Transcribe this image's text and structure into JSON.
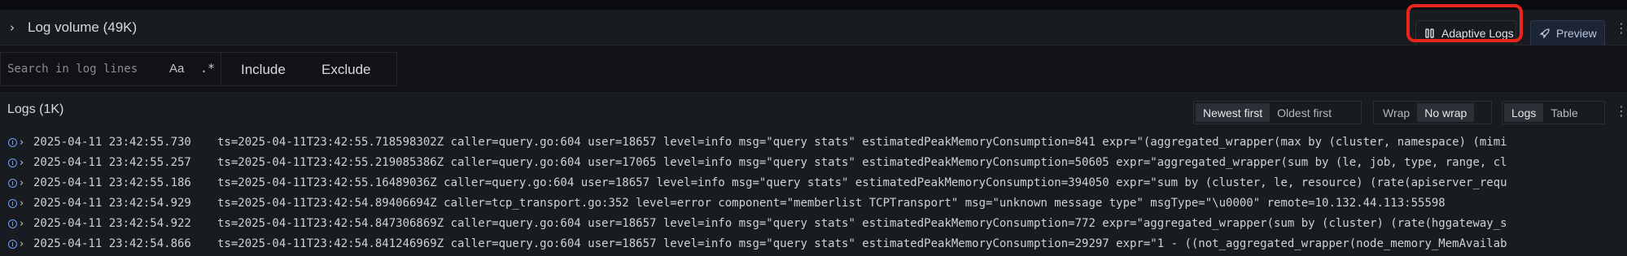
{
  "log_volume": {
    "title": "Log volume (49K)",
    "adaptive_logs_label": "Adaptive Logs",
    "preview_label": "Preview"
  },
  "search": {
    "placeholder": "Search in log lines",
    "case_label": "Aa",
    "regex_label": ".*",
    "include_label": "Include",
    "exclude_label": "Exclude"
  },
  "logs": {
    "title": "Logs (1K)",
    "sort_options": [
      "Newest first",
      "Oldest first"
    ],
    "sort_selected": "Newest first",
    "wrap_options": [
      "Wrap",
      "No wrap"
    ],
    "wrap_selected": "No wrap",
    "view_options": [
      "Logs",
      "Table"
    ],
    "view_selected": "Logs",
    "rows": [
      {
        "level": "info",
        "timestamp": "2025-04-11 23:42:55.730",
        "line": "ts=2025-04-11T23:42:55.718598302Z caller=query.go:604 user=18657 level=info msg=\"query stats\" estimatedPeakMemoryConsumption=841 expr=\"(aggregated_wrapper(max by (cluster, namespace) (mimi"
      },
      {
        "level": "info",
        "timestamp": "2025-04-11 23:42:55.257",
        "line": "ts=2025-04-11T23:42:55.219085386Z caller=query.go:604 user=17065 level=info msg=\"query stats\" estimatedPeakMemoryConsumption=50605 expr=\"aggregated_wrapper(sum by (le, job, type, range, cl"
      },
      {
        "level": "info",
        "timestamp": "2025-04-11 23:42:55.186",
        "line": "ts=2025-04-11T23:42:55.16489036Z caller=query.go:604 user=18657 level=info msg=\"query stats\" estimatedPeakMemoryConsumption=394050 expr=\"sum by (cluster, le, resource) (rate(apiserver_requ"
      },
      {
        "level": "error",
        "timestamp": "2025-04-11 23:42:54.929",
        "line": "ts=2025-04-11T23:42:54.89406694Z caller=tcp_transport.go:352 level=error component=\"memberlist TCPTransport\" msg=\"unknown message type\" msgType=\"\\u0000\" remote=10.132.44.113:55598"
      },
      {
        "level": "info",
        "timestamp": "2025-04-11 23:42:54.922",
        "line": "ts=2025-04-11T23:42:54.847306869Z caller=query.go:604 user=18657 level=info msg=\"query stats\" estimatedPeakMemoryConsumption=772 expr=\"aggregated_wrapper(sum by (cluster) (rate(hggateway_s"
      },
      {
        "level": "info",
        "timestamp": "2025-04-11 23:42:54.866",
        "line": "ts=2025-04-11T23:42:54.841246969Z caller=query.go:604 user=18657 level=info msg=\"query stats\" estimatedPeakMemoryConsumption=29297 expr=\"1 - ((not_aggregated_wrapper(node_memory_MemAvailab"
      }
    ]
  }
}
